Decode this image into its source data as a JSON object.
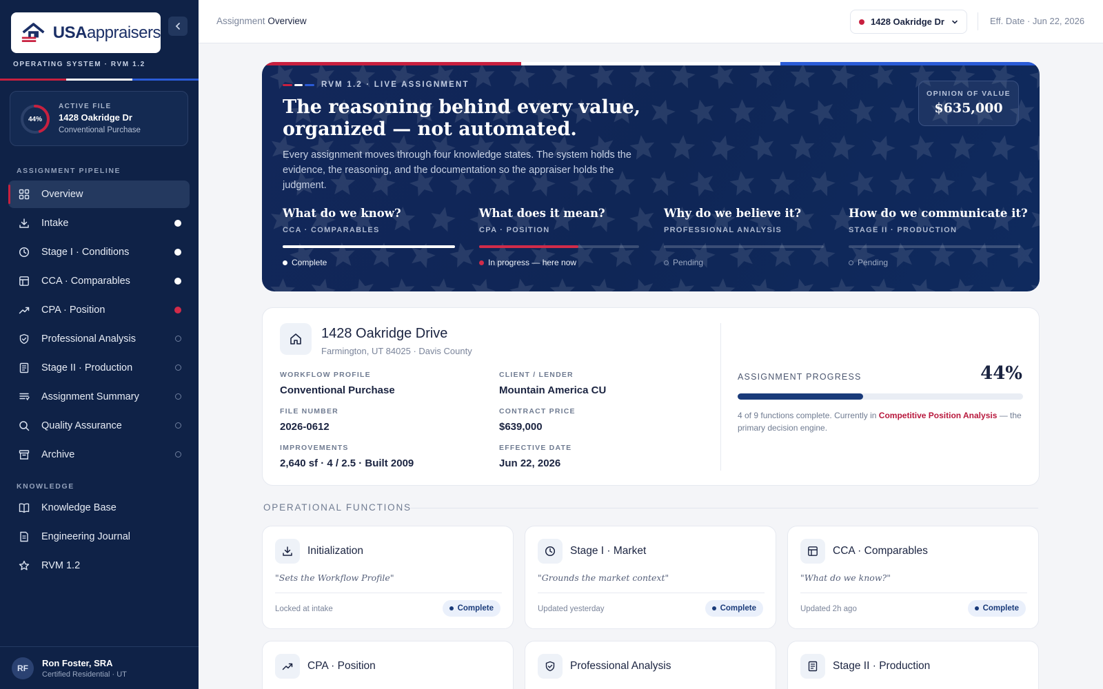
{
  "colors": {
    "navy": "#0f2247",
    "red": "#c8203f",
    "blue": "#2a5bd7",
    "white": "#ffffff"
  },
  "brand": {
    "logo_text_bold": "USA",
    "logo_text": "appraisers",
    "os_label": "OPERATING SYSTEM · RVM 1.2"
  },
  "active_file": {
    "progress_label": "44%",
    "progress": 0.44,
    "eyebrow": "ACTIVE FILE",
    "title": "1428 Oakridge Dr",
    "subtitle": "Conventional Purchase"
  },
  "sidebar": {
    "pipeline_heading": "ASSIGNMENT PIPELINE",
    "pipeline": [
      {
        "label": "Overview",
        "icon": "grid-icon",
        "status": "none",
        "active": true
      },
      {
        "label": "Intake",
        "icon": "download-icon",
        "status": "done"
      },
      {
        "label": "Stage I · Conditions",
        "icon": "clock-icon",
        "status": "done"
      },
      {
        "label": "CCA · Comparables",
        "icon": "table-icon",
        "status": "done"
      },
      {
        "label": "CPA · Position",
        "icon": "trend-icon",
        "status": "active"
      },
      {
        "label": "Professional Analysis",
        "icon": "shield-icon",
        "status": "pending"
      },
      {
        "label": "Stage II · Production",
        "icon": "document-icon",
        "status": "pending"
      },
      {
        "label": "Assignment Summary",
        "icon": "list-icon",
        "status": "pending"
      },
      {
        "label": "Quality Assurance",
        "icon": "search-icon",
        "status": "pending"
      },
      {
        "label": "Archive",
        "icon": "archive-icon",
        "status": "pending"
      }
    ],
    "knowledge_heading": "KNOWLEDGE",
    "knowledge": [
      {
        "label": "Knowledge Base",
        "icon": "book-icon"
      },
      {
        "label": "Engineering Journal",
        "icon": "journal-icon"
      },
      {
        "label": "RVM 1.2",
        "icon": "star-icon"
      }
    ]
  },
  "user": {
    "initials": "RF",
    "name": "Ron Foster, SRA",
    "role": "Certified Residential · UT"
  },
  "topbar": {
    "crumb_prefix": "Assignment",
    "crumb_current": "Overview",
    "file_selector": "1428 Oakridge Dr",
    "effective_date": "Eff. Date · Jun 22, 2026"
  },
  "hero": {
    "eyebrow": "RVM 1.2 · LIVE ASSIGNMENT",
    "title": "The reasoning behind every value, organized — not automated.",
    "description": "Every assignment moves through four knowledge states. The system holds the evidence, the reasoning, and the documentation so the appraiser holds the judgment.",
    "opinion_label": "OPINION OF VALUE",
    "opinion_value": "$635,000",
    "stages": [
      {
        "question": "What do we know?",
        "sub": "CCA · COMPARABLES",
        "progress": 1.0,
        "status": "Complete",
        "state": "done"
      },
      {
        "question": "What does it mean?",
        "sub": "CPA · POSITION",
        "progress": 0.62,
        "status": "In progress — here now",
        "state": "active"
      },
      {
        "question": "Why do we believe it?",
        "sub": "PROFESSIONAL ANALYSIS",
        "progress": 0,
        "status": "Pending",
        "state": "pending"
      },
      {
        "question": "How do we communicate it?",
        "sub": "STAGE II · PRODUCTION",
        "progress": 0,
        "status": "Pending",
        "state": "pending"
      }
    ]
  },
  "property": {
    "name": "1428 Oakridge Drive",
    "address": "Farmington, UT 84025 · Davis County",
    "fields": [
      {
        "label": "WORKFLOW PROFILE",
        "value": "Conventional Purchase"
      },
      {
        "label": "CLIENT / LENDER",
        "value": "Mountain America CU"
      },
      {
        "label": "FILE NUMBER",
        "value": "2026-0612"
      },
      {
        "label": "CONTRACT PRICE",
        "value": "$639,000"
      },
      {
        "label": "IMPROVEMENTS",
        "value": "2,640 sf · 4 / 2.5 · Built 2009"
      },
      {
        "label": "EFFECTIVE DATE",
        "value": "Jun 22, 2026"
      }
    ],
    "progress_label": "ASSIGNMENT PROGRESS",
    "progress_pct": "44%",
    "progress": 0.44,
    "note_prefix": "4 of 9 functions complete. Currently in ",
    "note_emphasis": "Competitive Position Analysis",
    "note_suffix": " — the primary decision engine."
  },
  "functions": {
    "heading": "OPERATIONAL FUNCTIONS",
    "cards": [
      {
        "title": "Initialization",
        "icon": "download-icon",
        "quote": "\"Sets the Workflow Profile\"",
        "meta": "Locked at intake",
        "badge": "Complete"
      },
      {
        "title": "Stage I · Market",
        "icon": "clock-icon",
        "quote": "\"Grounds the market context\"",
        "meta": "Updated yesterday",
        "badge": "Complete"
      },
      {
        "title": "CCA · Comparables",
        "icon": "table-icon",
        "quote": "\"What do we know?\"",
        "meta": "Updated 2h ago",
        "badge": "Complete"
      },
      {
        "title": "CPA · Position",
        "icon": "trend-icon"
      },
      {
        "title": "Professional Analysis",
        "icon": "shield-icon"
      },
      {
        "title": "Stage II · Production",
        "icon": "document-icon"
      }
    ]
  }
}
